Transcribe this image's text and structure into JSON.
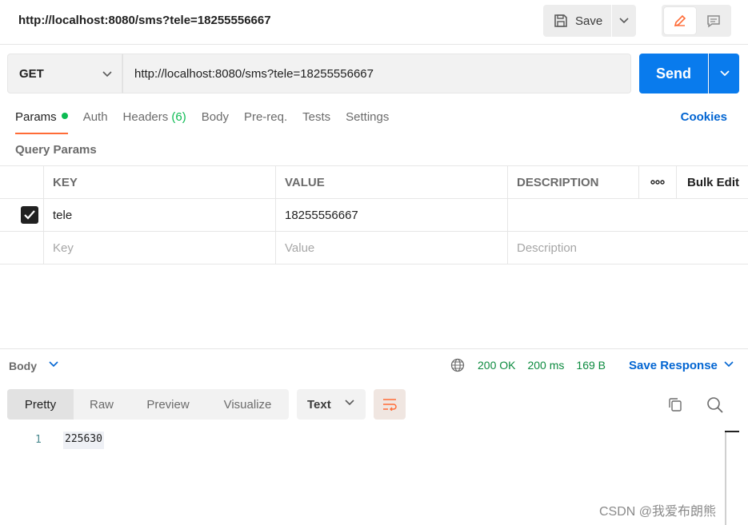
{
  "titlebar": {
    "url": "http://localhost:8080/sms?tele=18255556667",
    "save_label": "Save"
  },
  "request": {
    "method": "GET",
    "url": "http://localhost:8080/sms?tele=18255556667",
    "send_label": "Send"
  },
  "tabs": [
    {
      "label": "Params",
      "active": true
    },
    {
      "label": "Auth"
    },
    {
      "label": "Headers",
      "count": "(6)"
    },
    {
      "label": "Body"
    },
    {
      "label": "Pre-req."
    },
    {
      "label": "Tests"
    },
    {
      "label": "Settings"
    }
  ],
  "cookies_label": "Cookies",
  "query_params": {
    "title": "Query Params",
    "headers": {
      "key": "KEY",
      "value": "VALUE",
      "description": "DESCRIPTION",
      "bulk_edit": "Bulk Edit"
    },
    "rows": [
      {
        "checked": true,
        "key": "tele",
        "value": "18255556667",
        "description": ""
      }
    ],
    "placeholders": {
      "key": "Key",
      "value": "Value",
      "description": "Description"
    }
  },
  "response": {
    "section_label": "Body",
    "status": "200 OK",
    "time": "200 ms",
    "size": "169 B",
    "save_response_label": "Save Response",
    "view_tabs": [
      "Pretty",
      "Raw",
      "Preview",
      "Visualize"
    ],
    "active_view": "Pretty",
    "format": "Text",
    "lines": [
      {
        "number": "1",
        "text": "225630"
      }
    ]
  },
  "watermark": "CSDN @我爱布朗熊",
  "colors": {
    "accent": "#ff6c37",
    "send": "#097bed",
    "success": "#0cbb52",
    "link": "#0265d2"
  }
}
